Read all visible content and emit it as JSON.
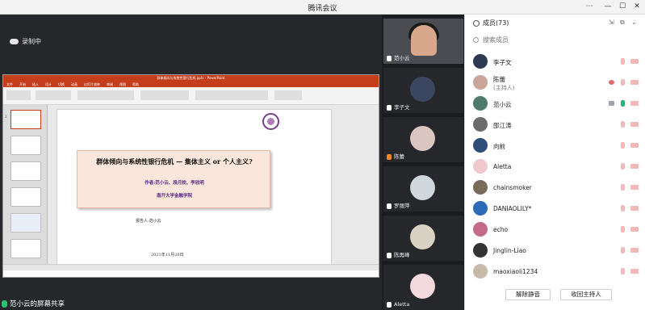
{
  "window": {
    "title": "腾讯会议",
    "controls": [
      "⋯",
      "—",
      "☐",
      "✕"
    ]
  },
  "stage": {
    "recording_label": "录制中",
    "share_label": "范小云的屏幕共享",
    "ppt": {
      "title": "群体倾向与系统性银行危机.pptx - PowerPoint",
      "tabs": [
        "文件",
        "开始",
        "插入",
        "设计",
        "切换",
        "动画",
        "幻灯片放映",
        "审阅",
        "视图",
        "帮助"
      ],
      "slide": {
        "title": "群体倾向与系统性银行危机 — 集体主义 or 个人主义?",
        "authors": "作者:范小云、段月姣、李欣明",
        "affiliation": "南开大学金融学院",
        "presenter": "报告人:范小云",
        "date": "2021年11月20日"
      }
    }
  },
  "videos": [
    {
      "name": "范小云",
      "type": "speaker"
    },
    {
      "name": "李子文",
      "color": "#3a4660"
    },
    {
      "name": "陈蕾",
      "color": "#d9c6c0"
    },
    {
      "name": "罗丽萍",
      "color": "#cfd6dc"
    },
    {
      "name": "陈再峰",
      "color": "#d9d2c4"
    },
    {
      "name": "Aletta",
      "color": "#f3d9db"
    }
  ],
  "members": {
    "header": "成员(73)",
    "search_placeholder": "搜索成员",
    "list": [
      {
        "name": "李子文",
        "role": "",
        "avatar_color": "#2e3a52",
        "mic": "muted",
        "cam": "muted"
      },
      {
        "name": "陈蕾",
        "role": "(主持人)",
        "avatar_color": "#c9a59a",
        "mic": "muted",
        "cam": "muted",
        "extra": "#e06a6a"
      },
      {
        "name": "范小云",
        "role": "",
        "avatar_color": "#4e7a6a",
        "mic": "on",
        "cam": "muted",
        "extra": "#9aa6b2"
      },
      {
        "name": "邵江涛",
        "role": "",
        "avatar_color": "#6b6b6b",
        "mic": "muted",
        "cam": "muted"
      },
      {
        "name": "向前",
        "role": "",
        "avatar_color": "#2f4d7a",
        "mic": "muted",
        "cam": "muted"
      },
      {
        "name": "Aletta",
        "role": "",
        "avatar_color": "#f0c9cf",
        "mic": "muted",
        "cam": "muted"
      },
      {
        "name": "chainsmoker",
        "role": "",
        "avatar_color": "#7a6a5a",
        "mic": "muted",
        "cam": "muted"
      },
      {
        "name": "DANIAOLILY*",
        "role": "",
        "avatar_color": "#2d6bb8",
        "mic": "muted",
        "cam": "muted"
      },
      {
        "name": "echo",
        "role": "",
        "avatar_color": "#c46b8a",
        "mic": "muted",
        "cam": "muted"
      },
      {
        "name": "Jinglin-Liao",
        "role": "",
        "avatar_color": "#333333",
        "mic": "muted",
        "cam": "muted"
      },
      {
        "name": "maoxiaoli1234",
        "role": "",
        "avatar_color": "#c8b8a8",
        "mic": "muted",
        "cam": "muted"
      }
    ],
    "mute_all_button": "解除静音",
    "reclaim_host_button": "收回主持人"
  }
}
